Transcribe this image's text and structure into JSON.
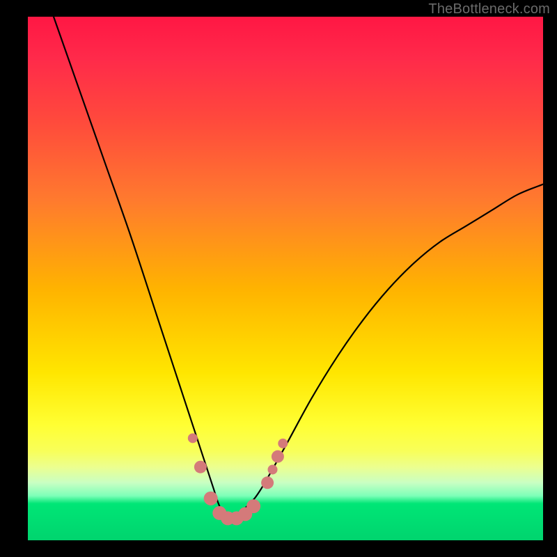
{
  "watermark": {
    "text": "TheBottleneck.com"
  },
  "colors": {
    "background": "#000000",
    "curve": "#000000",
    "marker_fill": "#d47a7a",
    "marker_stroke": "#c46a6a",
    "gradient_stops": [
      "#ff1744",
      "#ff7a2e",
      "#ffe600",
      "#f8ff5a",
      "#00e676"
    ]
  },
  "chart_data": {
    "type": "line",
    "title": "",
    "xlabel": "",
    "ylabel": "",
    "xlim": [
      0,
      100
    ],
    "ylim": [
      0,
      100
    ],
    "grid": false,
    "legend": false,
    "description": "V-shaped bottleneck curve over rainbow gradient; minimum near x≈39; salmon dot markers cluster near the trough.",
    "series": [
      {
        "name": "bottleneck-curve",
        "x": [
          5,
          10,
          15,
          20,
          25,
          28,
          30,
          32,
          34,
          36,
          37,
          38,
          39,
          40,
          41,
          42,
          44,
          46,
          50,
          55,
          60,
          65,
          70,
          75,
          80,
          85,
          90,
          95,
          100
        ],
        "y": [
          100,
          86,
          72,
          58,
          43,
          34,
          28,
          22,
          16,
          10,
          7,
          5,
          4,
          4,
          5,
          6,
          8,
          11,
          18,
          27,
          35,
          42,
          48,
          53,
          57,
          60,
          63,
          66,
          68
        ]
      }
    ],
    "markers": [
      {
        "x": 32.0,
        "y": 19.5,
        "r": 7
      },
      {
        "x": 33.5,
        "y": 14.0,
        "r": 9
      },
      {
        "x": 35.5,
        "y": 8.0,
        "r": 10
      },
      {
        "x": 37.2,
        "y": 5.2,
        "r": 10
      },
      {
        "x": 38.8,
        "y": 4.2,
        "r": 10
      },
      {
        "x": 40.5,
        "y": 4.2,
        "r": 10
      },
      {
        "x": 42.2,
        "y": 5.0,
        "r": 10
      },
      {
        "x": 43.8,
        "y": 6.5,
        "r": 10
      },
      {
        "x": 46.5,
        "y": 11.0,
        "r": 9
      },
      {
        "x": 47.5,
        "y": 13.5,
        "r": 7
      },
      {
        "x": 48.5,
        "y": 16.0,
        "r": 9
      },
      {
        "x": 49.5,
        "y": 18.5,
        "r": 7
      }
    ]
  }
}
